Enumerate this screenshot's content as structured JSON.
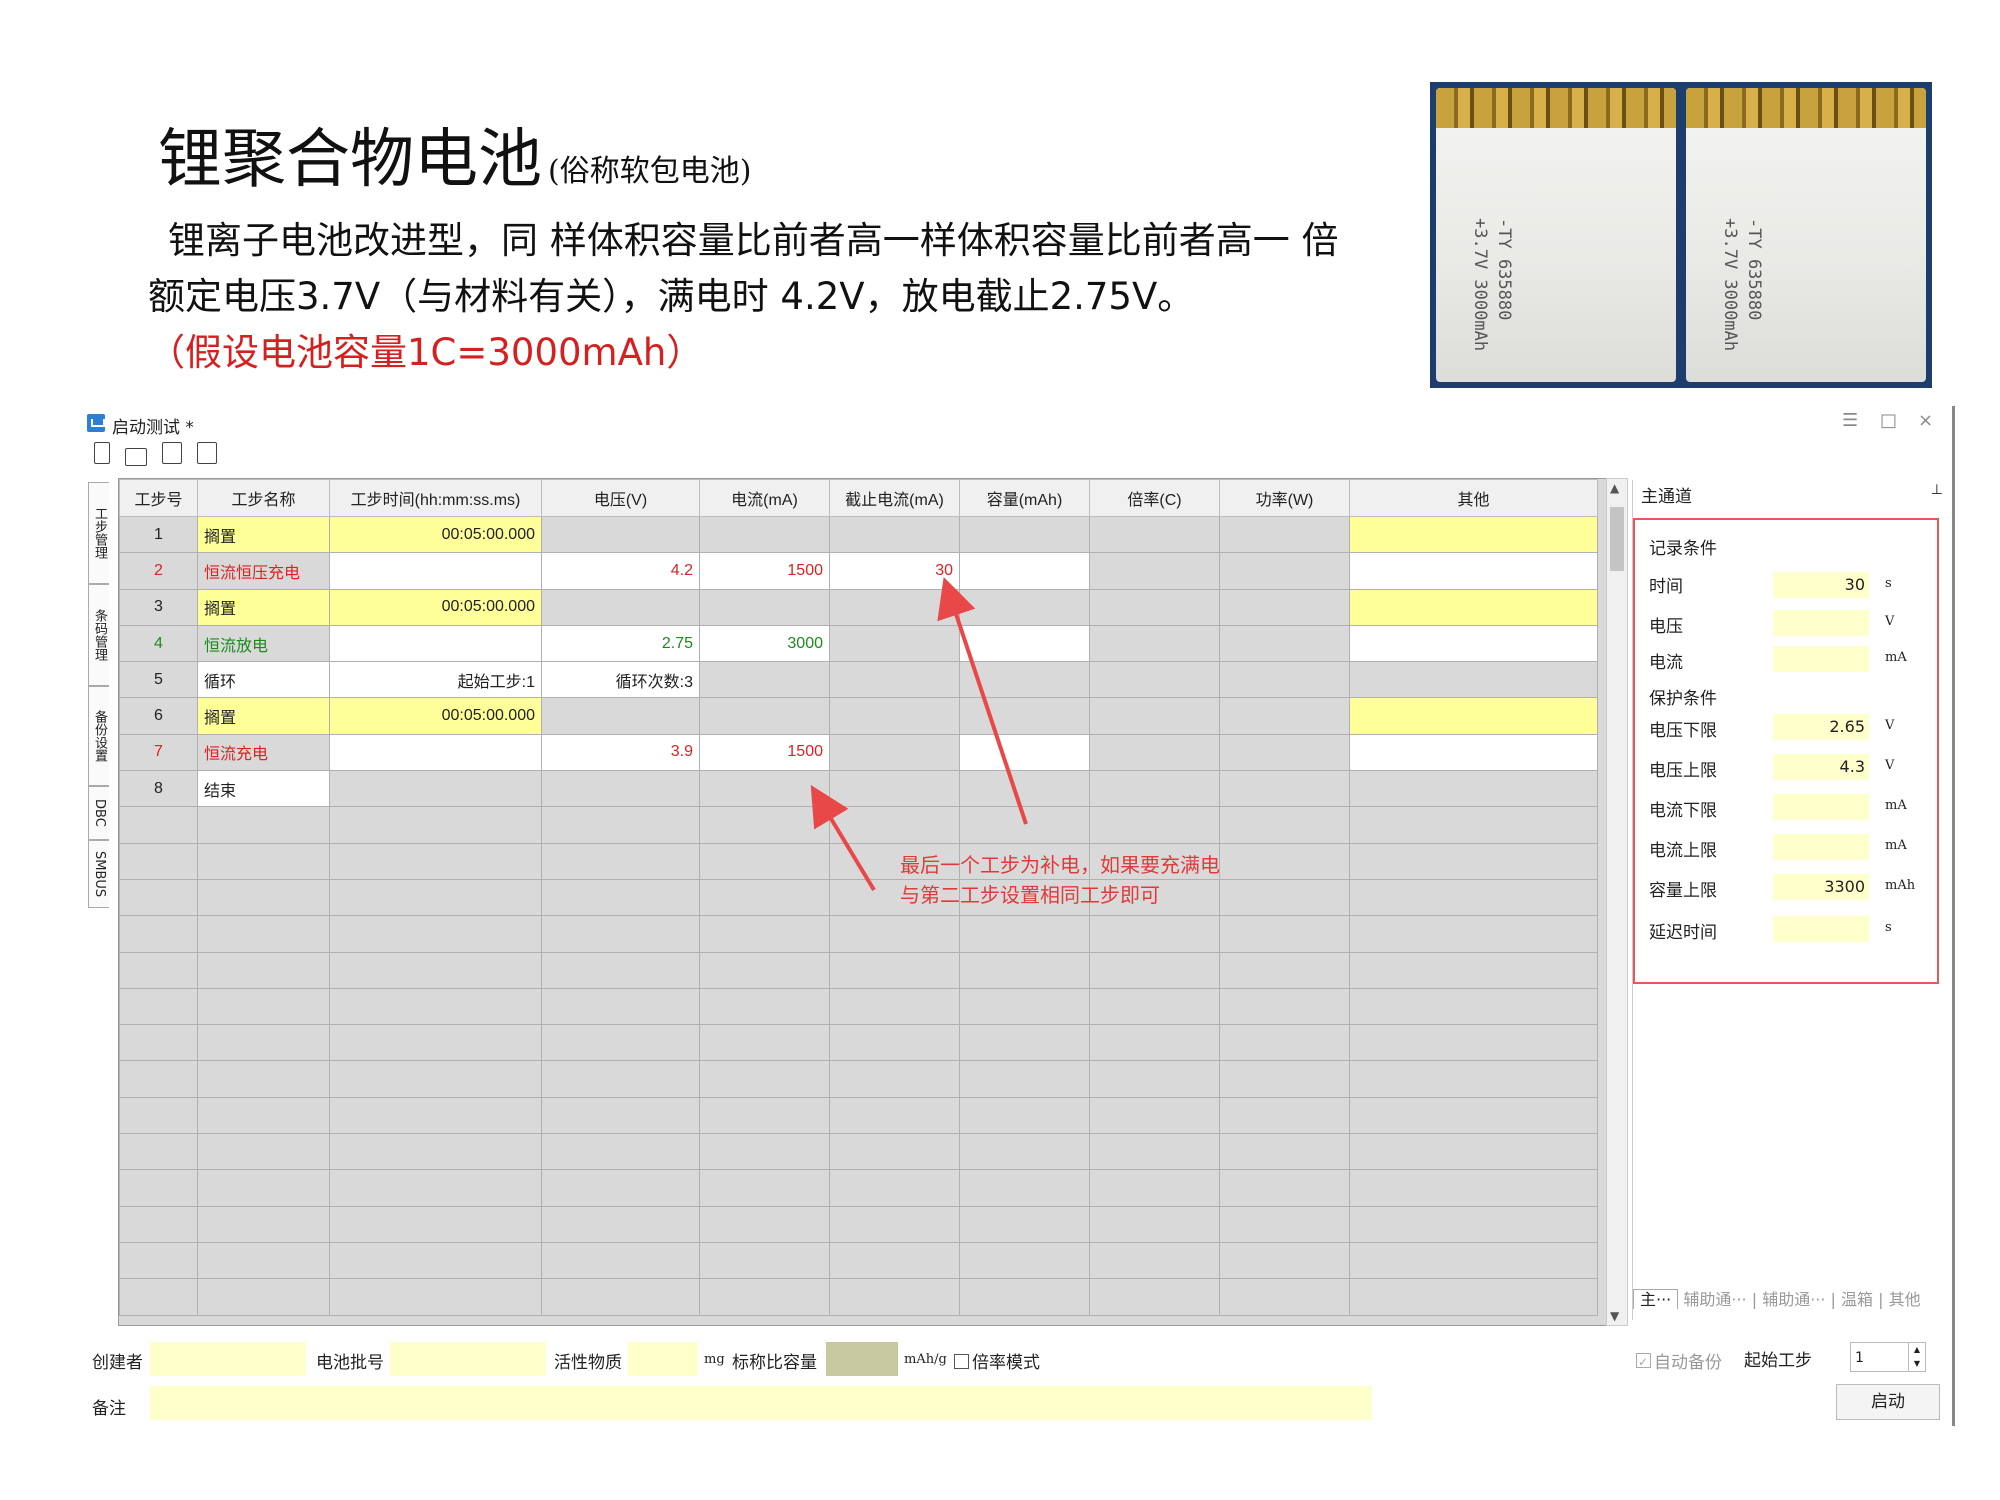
{
  "slide": {
    "title": "锂聚合物电池",
    "title_sub": "(俗称软包电池)",
    "desc_line1": "锂离子电池改进型，同 样体积容量比前者高一样体积容量比前者高一 倍",
    "desc_line2": "额定电压3.7V（与材料有关），满电时 4.2V，放电截止2.75V。",
    "desc_line3": "（假设电池容量1C=3000mAh）"
  },
  "battery_label": "-TY 635880\n+3.7V 3000mAh",
  "window": {
    "title": "启动测试 *",
    "controls": [
      "☰",
      "□",
      "×"
    ]
  },
  "side_tabs": [
    "工步管理",
    "条码管理",
    "备份设置",
    "DBC",
    "SMBUS"
  ],
  "columns": [
    "工步号",
    "工步名称",
    "工步时间(hh:mm:ss.ms)",
    "电压(V)",
    "电流(mA)",
    "截止电流(mA)",
    "容量(mAh)",
    "倍率(C)",
    "功率(W)",
    "其他"
  ],
  "steps": [
    {
      "no": "1",
      "name": "搁置",
      "time": "00:05:00.000",
      "voltage": "",
      "current": "",
      "cutoff": ""
    },
    {
      "no": "2",
      "name": "恒流恒压充电",
      "time": "",
      "voltage": "4.2",
      "current": "1500",
      "cutoff": "30"
    },
    {
      "no": "3",
      "name": "搁置",
      "time": "00:05:00.000",
      "voltage": "",
      "current": "",
      "cutoff": ""
    },
    {
      "no": "4",
      "name": "恒流放电",
      "time": "",
      "voltage": "2.75",
      "current": "3000",
      "cutoff": ""
    },
    {
      "no": "5",
      "name": "循环",
      "time": "起始工步:1",
      "voltage": "循环次数:3",
      "current": "",
      "cutoff": ""
    },
    {
      "no": "6",
      "name": "搁置",
      "time": "00:05:00.000",
      "voltage": "",
      "current": "",
      "cutoff": ""
    },
    {
      "no": "7",
      "name": "恒流充电",
      "time": "",
      "voltage": "3.9",
      "current": "1500",
      "cutoff": ""
    },
    {
      "no": "8",
      "name": "结束",
      "time": "",
      "voltage": "",
      "current": "",
      "cutoff": ""
    }
  ],
  "annotation": [
    "最后一个工步为补电，如果要充满电",
    "与第二工步设置相同工步即可"
  ],
  "panel": {
    "title": "主通道",
    "record_header": "记录条件",
    "time_label": "时间",
    "time_value": "30",
    "time_unit": "s",
    "voltage_label": "电压",
    "voltage_unit": "V",
    "current_label": "电流",
    "current_unit": "mA",
    "protect_header": "保护条件",
    "vmin_label": "电压下限",
    "vmin_value": "2.65",
    "vmin_unit": "V",
    "vmax_label": "电压上限",
    "vmax_value": "4.3",
    "vmax_unit": "V",
    "imin_label": "电流下限",
    "imin_unit": "mA",
    "imax_label": "电流上限",
    "imax_unit": "mA",
    "cap_label": "容量上限",
    "cap_value": "3300",
    "cap_unit": "mAh",
    "delay_label": "延迟时间",
    "delay_unit": "s",
    "tabs": [
      "主···",
      "辅助通···",
      "辅助通···",
      "温箱",
      "其他"
    ]
  },
  "bottom": {
    "creator_label": "创建者",
    "batch_label": "电池批号",
    "active_label": "活性物质",
    "active_unit": "mg",
    "spec_cap_label": "标称比容量",
    "spec_cap_unit": "mAh/g",
    "rate_mode_label": "倍率模式",
    "remark_label": "备注",
    "auto_backup_label": "自动备份",
    "start_step_label": "起始工步",
    "start_step_value": "1",
    "start_button": "启动"
  }
}
